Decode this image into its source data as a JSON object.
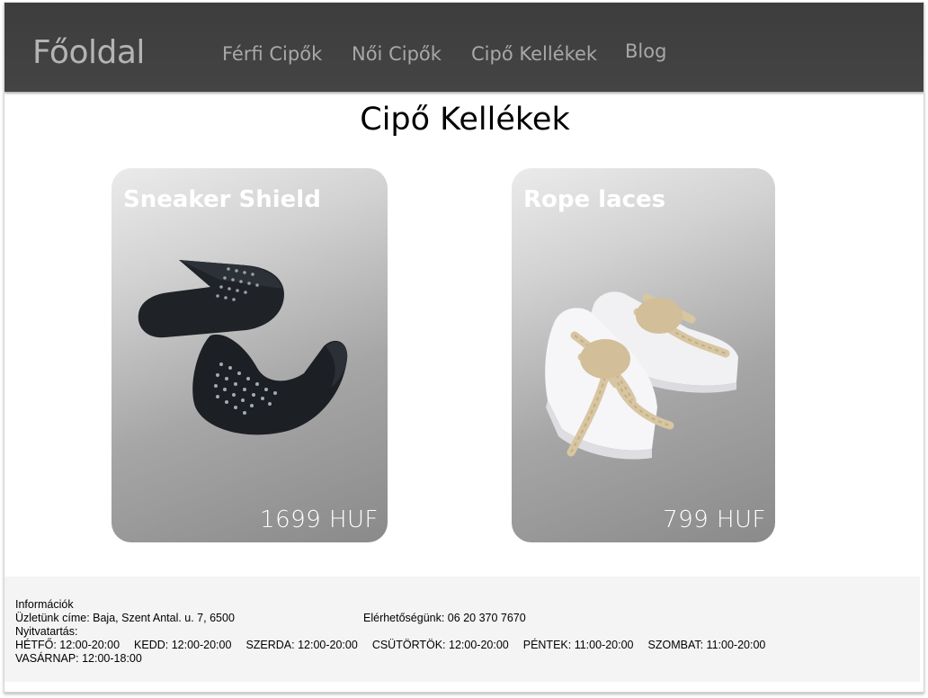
{
  "header": {
    "brand": "Főoldal",
    "nav": [
      "Férfi Cipők",
      "Női Cipők",
      "Cipő Kellékek",
      "Blog"
    ]
  },
  "page": {
    "title": "Cipő Kellékek"
  },
  "products": [
    {
      "name": "Sneaker Shield",
      "price": "1699 HUF"
    },
    {
      "name": "Rope laces",
      "price": "799 HUF"
    }
  ],
  "footer": {
    "heading": "Információk",
    "address": "Üzletünk címe: Baja, Szent Antal. u. 7, 6500",
    "contact": "Elérhetőségünk: 06 20 370 7670",
    "hours_label": "Nyitvatartás:",
    "hours": [
      "HÉTFŐ: 12:00-20:00",
      "KEDD: 12:00-20:00",
      "SZERDA: 12:00-20:00",
      "CSÜTÖRTÖK: 12:00-20:00",
      "PÉNTEK: 11:00-20:00",
      "SZOMBAT: 11:00-20:00",
      "VASÁRNAP: 12:00-18:00"
    ]
  },
  "colors": {
    "navbar": "#404040",
    "nav_text": "#a8a8a8",
    "footer_bg": "#f4f4f4"
  }
}
